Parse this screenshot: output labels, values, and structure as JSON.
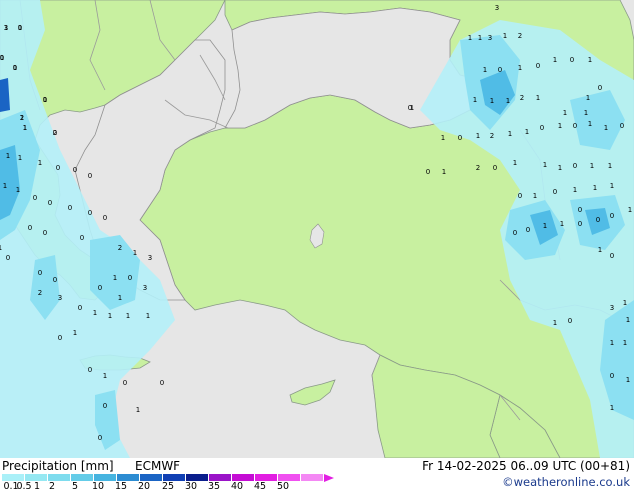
{
  "footer": {
    "title": "Precipitation [mm]",
    "model": "ECMWF",
    "datetime": "Fr 14-02-2025 06..09 UTC (00+81)",
    "credit": "©weatheronline.co.uk"
  },
  "legend": {
    "labels": [
      "0.1",
      "0.5",
      "1",
      "2",
      "5",
      "10",
      "15",
      "20",
      "25",
      "30",
      "35",
      "40",
      "45",
      "50"
    ],
    "colors": [
      "#aaf0f8",
      "#96e8f2",
      "#7edcee",
      "#64cce8",
      "#46b4e0",
      "#2c8cd2",
      "#1a64c4",
      "#1040b4",
      "#0a1e8c",
      "#9a14c8",
      "#c40cd4",
      "#e21ee2",
      "#f050f0",
      "#f488f4"
    ]
  },
  "map": {
    "colors": {
      "sea": "#e6e6e6",
      "land": "#c8f0a0",
      "border": "#a0a0a0",
      "coast": "#909090",
      "light_rain": "#b4f0f8",
      "rain": "#8ce0f2",
      "heavy_rain": "#50bce6"
    },
    "values": [
      {
        "t": "1"
      },
      {
        "t": "0"
      },
      {
        "t": "1"
      },
      {
        "t": "0"
      },
      {
        "t": "0"
      },
      {
        "t": "1"
      },
      {
        "t": "1"
      },
      {
        "t": "0"
      },
      {
        "t": "1"
      },
      {
        "t": "1"
      },
      {
        "t": "1"
      },
      {
        "t": "0"
      },
      {
        "t": "0"
      },
      {
        "t": "0"
      },
      {
        "t": "1"
      },
      {
        "t": "1"
      },
      {
        "t": "0"
      },
      {
        "t": "0"
      },
      {
        "t": "0"
      },
      {
        "t": "0"
      },
      {
        "t": "0"
      },
      {
        "t": "0"
      },
      {
        "t": "0"
      },
      {
        "t": "0"
      },
      {
        "t": "2"
      },
      {
        "t": "3"
      },
      {
        "t": "0"
      },
      {
        "t": "1"
      },
      {
        "t": "1"
      },
      {
        "t": "1"
      },
      {
        "t": "1"
      },
      {
        "t": "1"
      },
      {
        "t": "0"
      },
      {
        "t": "0"
      },
      {
        "t": "1"
      },
      {
        "t": "0"
      },
      {
        "t": "0"
      },
      {
        "t": "0"
      },
      {
        "t": "1"
      },
      {
        "t": "0"
      },
      {
        "t": "3"
      },
      {
        "t": "1"
      },
      {
        "t": "1"
      },
      {
        "t": "3"
      },
      {
        "t": "1"
      },
      {
        "t": "2"
      },
      {
        "t": "1"
      },
      {
        "t": "0"
      },
      {
        "t": "1"
      },
      {
        "t": "0"
      },
      {
        "t": "1"
      },
      {
        "t": "0"
      },
      {
        "t": "1"
      },
      {
        "t": "1"
      },
      {
        "t": "1"
      },
      {
        "t": "1"
      },
      {
        "t": "2"
      },
      {
        "t": "1"
      },
      {
        "t": "1"
      },
      {
        "t": "1"
      },
      {
        "t": "0"
      },
      {
        "t": "1"
      },
      {
        "t": "2"
      },
      {
        "t": "1"
      },
      {
        "t": "1"
      },
      {
        "t": "0"
      },
      {
        "t": "1"
      },
      {
        "t": "0"
      },
      {
        "t": "1"
      },
      {
        "t": "1"
      },
      {
        "t": "0"
      },
      {
        "t": "1"
      },
      {
        "t": "1"
      },
      {
        "t": "1"
      },
      {
        "t": "0"
      },
      {
        "t": "1"
      },
      {
        "t": "1"
      },
      {
        "t": "0"
      },
      {
        "t": "1"
      },
      {
        "t": "2"
      },
      {
        "t": "0"
      },
      {
        "t": "0"
      },
      {
        "t": "1"
      },
      {
        "t": "0"
      },
      {
        "t": "1"
      },
      {
        "t": "1"
      },
      {
        "t": "1"
      },
      {
        "t": "0"
      },
      {
        "t": "0"
      },
      {
        "t": "0"
      },
      {
        "t": "1"
      },
      {
        "t": "0"
      },
      {
        "t": "0"
      },
      {
        "t": "1"
      },
      {
        "t": "1"
      },
      {
        "t": "0"
      },
      {
        "t": "1"
      },
      {
        "t": "0"
      },
      {
        "t": "1"
      },
      {
        "t": "3"
      },
      {
        "t": "1"
      },
      {
        "t": "1"
      },
      {
        "t": "0"
      },
      {
        "t": "1"
      },
      {
        "t": "1"
      },
      {
        "t": "0"
      },
      {
        "t": "1"
      },
      {
        "t": "1"
      },
      {
        "t": "0"
      },
      {
        "t": "0"
      },
      {
        "t": "1"
      },
      {
        "t": "1"
      },
      {
        "t": "1"
      },
      {
        "t": "2"
      },
      {
        "t": "1"
      },
      {
        "t": "3"
      },
      {
        "t": "1"
      },
      {
        "t": "0"
      },
      {
        "t": "1"
      },
      {
        "t": "1"
      },
      {
        "t": "0"
      },
      {
        "t": "0"
      },
      {
        "t": "0"
      },
      {
        "t": "0"
      },
      {
        "t": "3"
      },
      {
        "t": "3"
      },
      {
        "t": "1"
      },
      {
        "t": "0"
      },
      {
        "t": "1"
      },
      {
        "t": "1"
      },
      {
        "t": "2"
      },
      {
        "t": "1"
      },
      {
        "t": "2"
      }
    ]
  }
}
